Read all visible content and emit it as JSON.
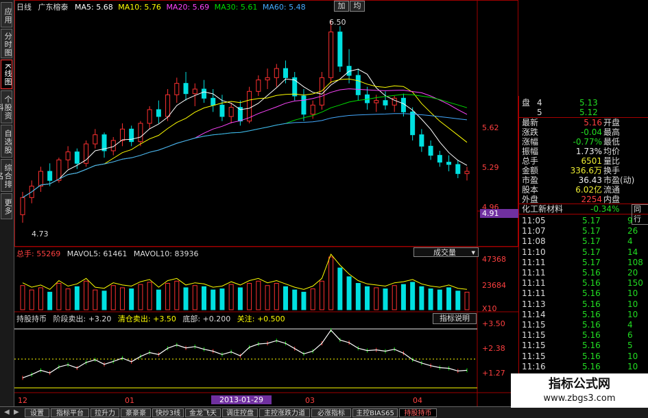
{
  "sidebar": {
    "tabs": [
      {
        "label": "应用",
        "active": false
      },
      {
        "label": "分时图",
        "active": false
      },
      {
        "label": "K线图",
        "active": true
      },
      {
        "label": "个股资料",
        "active": false
      },
      {
        "label": "自选股",
        "active": false
      },
      {
        "label": "综合排名",
        "active": false
      },
      {
        "label": "更多",
        "active": false
      }
    ]
  },
  "header": {
    "period": "日线",
    "stock": "广东榕泰",
    "ma5": "MA5: 5.68",
    "ma10": "MA10: 5.76",
    "ma20": "MA20: 5.69",
    "ma30": "MA30: 5.61",
    "ma60": "MA60: 5.48",
    "btn_add": "加",
    "btn_avg": "均"
  },
  "price_panel": {
    "high_label": "6.50",
    "low_label": "4.73",
    "axis_ticks": [
      "5.62",
      "5.29",
      "4.96"
    ],
    "current_box": "4.91"
  },
  "volume_panel": {
    "header_total": "总手: 55269",
    "header_mavol5": "MAVOL5: 61461",
    "header_mavol10": "MAVOL10: 83936",
    "selector": "成交量",
    "axis_ticks": [
      "47368",
      "23684",
      "X10"
    ]
  },
  "indicator_panel": {
    "name": "持股持币",
    "label1": "阶段卖出: +3.20",
    "label2": "清仓卖出: +3.50",
    "label3": "底部: +0.200",
    "label4": "关注: +0.500",
    "explain_btn": "指标说明",
    "axis_ticks": [
      "+3.50",
      "+2.38",
      "+1.27"
    ]
  },
  "x_axis": {
    "labels": [
      "12",
      "01",
      "03",
      "04"
    ],
    "date_box": "2013-01-29"
  },
  "quote": {
    "ask_rows": [
      {
        "label": "盘",
        "level": "4",
        "price": "5.13"
      },
      {
        "label": "",
        "level": "5",
        "price": "5.12"
      }
    ],
    "stats": [
      {
        "l1": "最新",
        "v1": "5.16",
        "l2": "开盘",
        "v1c": "#ff4040"
      },
      {
        "l1": "涨跌",
        "v1": "-0.04",
        "l2": "最高",
        "v1c": "#22dd22"
      },
      {
        "l1": "涨幅",
        "v1": "-0.77%",
        "l2": "最低",
        "v1c": "#22dd22"
      },
      {
        "l1": "振幅",
        "v1": "1.73%",
        "l2": "均价",
        "v1c": "#eeeeee"
      },
      {
        "l1": "总手",
        "v1": "6501",
        "l2": "量比",
        "v1c": "#eeee33"
      },
      {
        "l1": "金额",
        "v1": "336.6万",
        "l2": "换手",
        "v1c": "#eeee33"
      },
      {
        "l1": "市盈",
        "v1": "36.43",
        "l2": "市盈(动)",
        "v1c": "#eeeeee"
      },
      {
        "l1": "股本",
        "v1": "6.02亿",
        "l2": "流通",
        "v1c": "#eeee33"
      },
      {
        "l1": "外盘",
        "v1": "2254",
        "l2": "内盘",
        "v1c": "#ff4040"
      }
    ],
    "sector": "化工新材料",
    "sector_change": "-0.34%",
    "sector_tab": "同行",
    "ticks": [
      {
        "time": "11:05",
        "price": "5.17",
        "vol": "9"
      },
      {
        "time": "11:07",
        "price": "5.17",
        "vol": "26"
      },
      {
        "time": "11:08",
        "price": "5.17",
        "vol": "4"
      },
      {
        "time": "11:10",
        "price": "5.17",
        "vol": "14"
      },
      {
        "time": "11:11",
        "price": "5.17",
        "vol": "108"
      },
      {
        "time": "11:11",
        "price": "5.16",
        "vol": "20"
      },
      {
        "time": "11:11",
        "price": "5.16",
        "vol": "150"
      },
      {
        "time": "11:11",
        "price": "5.16",
        "vol": "10"
      },
      {
        "time": "11:13",
        "price": "5.16",
        "vol": "10"
      },
      {
        "time": "11:14",
        "price": "5.16",
        "vol": "10"
      },
      {
        "time": "11:15",
        "price": "5.16",
        "vol": "4"
      },
      {
        "time": "11:15",
        "price": "5.16",
        "vol": "6"
      },
      {
        "time": "11:15",
        "price": "5.16",
        "vol": "5"
      },
      {
        "time": "11:15",
        "price": "5.16",
        "vol": "10"
      },
      {
        "time": "11:16",
        "price": "5.16",
        "vol": "10"
      },
      {
        "time": "11:16",
        "price": "5.16",
        "vol": "10"
      }
    ]
  },
  "bottom_tabs": [
    "设置",
    "指标平台",
    "拉升力",
    "豪豪豪",
    "快炒3线",
    "金龙飞天",
    "调庄控盘",
    "主控涨跌力道",
    "必涨指标",
    "主控BIAS65",
    "持股持币"
  ],
  "watermark": {
    "line1": "指标公式网",
    "line2": "www.zbgs3.com"
  },
  "colors": {
    "up": "#ff3030",
    "down": "#00e0e0",
    "ma5": "#ffffff",
    "ma10": "#ffff00",
    "ma20": "#ff44ff",
    "ma30": "#00dd00",
    "ma60": "#44aaff"
  },
  "chart_data": {
    "type": "candlestick",
    "ohlc": [
      [
        4.8,
        5.0,
        4.73,
        4.95
      ],
      [
        4.95,
        5.1,
        4.9,
        5.05
      ],
      [
        5.05,
        5.22,
        5.0,
        5.18
      ],
      [
        5.18,
        5.25,
        5.05,
        5.1
      ],
      [
        5.1,
        5.3,
        5.08,
        5.28
      ],
      [
        5.28,
        5.4,
        5.2,
        5.35
      ],
      [
        5.35,
        5.38,
        5.2,
        5.25
      ],
      [
        5.25,
        5.45,
        5.22,
        5.42
      ],
      [
        5.42,
        5.55,
        5.38,
        5.5
      ],
      [
        5.5,
        5.52,
        5.3,
        5.36
      ],
      [
        5.36,
        5.48,
        5.32,
        5.45
      ],
      [
        5.45,
        5.6,
        5.4,
        5.55
      ],
      [
        5.55,
        5.58,
        5.4,
        5.44
      ],
      [
        5.44,
        5.62,
        5.4,
        5.6
      ],
      [
        5.6,
        5.75,
        5.55,
        5.72
      ],
      [
        5.72,
        5.8,
        5.6,
        5.66
      ],
      [
        5.66,
        5.9,
        5.62,
        5.85
      ],
      [
        5.85,
        6.0,
        5.78,
        5.95
      ],
      [
        5.95,
        6.05,
        5.8,
        5.86
      ],
      [
        5.86,
        5.95,
        5.75,
        5.9
      ],
      [
        5.9,
        5.98,
        5.78,
        5.82
      ],
      [
        5.82,
        5.9,
        5.7,
        5.76
      ],
      [
        5.76,
        5.85,
        5.62,
        5.66
      ],
      [
        5.66,
        5.78,
        5.6,
        5.74
      ],
      [
        5.74,
        5.8,
        5.58,
        5.62
      ],
      [
        5.62,
        5.92,
        5.6,
        5.88
      ],
      [
        5.88,
        6.02,
        5.84,
        5.98
      ],
      [
        5.98,
        6.08,
        5.9,
        6.0
      ],
      [
        6.0,
        6.12,
        5.92,
        6.08
      ],
      [
        6.08,
        6.15,
        5.95,
        6.0
      ],
      [
        6.0,
        6.05,
        5.8,
        5.84
      ],
      [
        5.84,
        5.9,
        5.62,
        5.68
      ],
      [
        5.68,
        5.8,
        5.64,
        5.76
      ],
      [
        5.76,
        6.05,
        5.72,
        6.0
      ],
      [
        6.0,
        6.5,
        5.95,
        6.4
      ],
      [
        6.4,
        6.45,
        6.05,
        6.1
      ],
      [
        6.1,
        6.25,
        5.95,
        6.02
      ],
      [
        6.02,
        6.08,
        5.8,
        5.85
      ],
      [
        5.85,
        5.92,
        5.72,
        5.78
      ],
      [
        5.78,
        5.85,
        5.7,
        5.8
      ],
      [
        5.8,
        5.88,
        5.72,
        5.76
      ],
      [
        5.76,
        5.84,
        5.7,
        5.82
      ],
      [
        5.82,
        5.86,
        5.66,
        5.7
      ],
      [
        5.7,
        5.74,
        5.45,
        5.5
      ],
      [
        5.5,
        5.55,
        5.35,
        5.4
      ],
      [
        5.4,
        5.45,
        5.28,
        5.32
      ],
      [
        5.32,
        5.36,
        5.22,
        5.26
      ],
      [
        5.26,
        5.32,
        5.18,
        5.24
      ],
      [
        5.24,
        5.28,
        5.12,
        5.16
      ],
      [
        5.16,
        5.22,
        5.1,
        5.18
      ]
    ],
    "volume": [
      22,
      18,
      20,
      16,
      24,
      19,
      21,
      26,
      18,
      17,
      22,
      20,
      19,
      23,
      25,
      18,
      24,
      26,
      20,
      22,
      21,
      18,
      19,
      23,
      20,
      24,
      26,
      22,
      24,
      21,
      18,
      16,
      19,
      26,
      48,
      38,
      30,
      24,
      21,
      20,
      19,
      22,
      23,
      25,
      21,
      19,
      18,
      20,
      17,
      16
    ],
    "ylim": [
      4.73,
      6.5
    ]
  }
}
